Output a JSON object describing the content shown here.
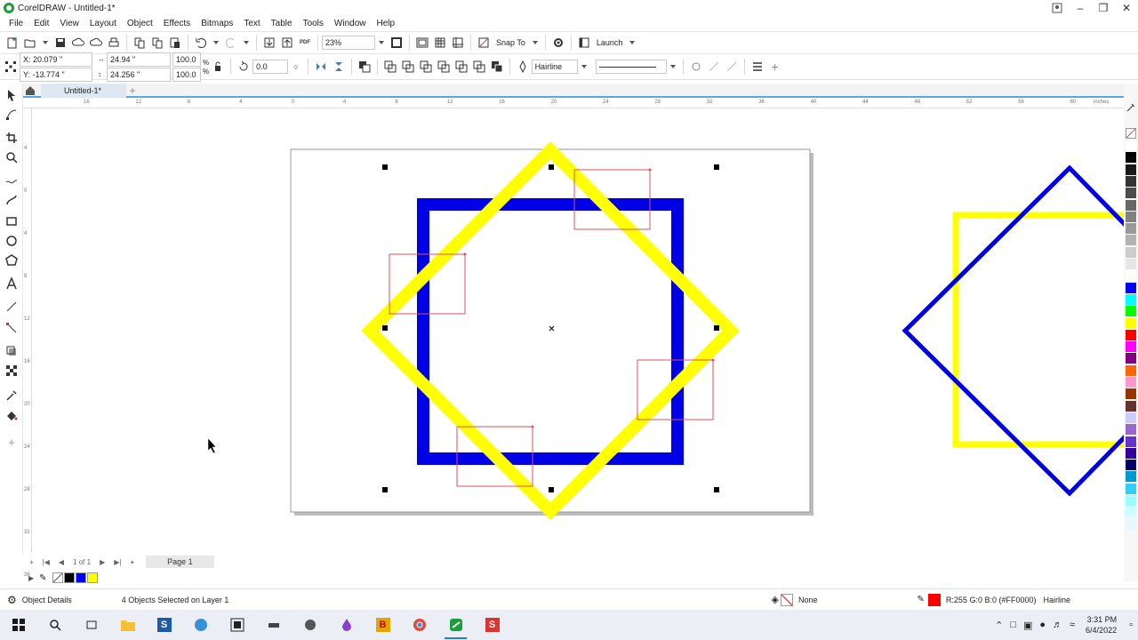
{
  "window": {
    "title": "CorelDRAW - Untitled-1*"
  },
  "menu": [
    "File",
    "Edit",
    "View",
    "Layout",
    "Object",
    "Effects",
    "Bitmaps",
    "Text",
    "Table",
    "Tools",
    "Window",
    "Help"
  ],
  "toolbar": {
    "zoom": "23%",
    "snap_to": "Snap To",
    "launch": "Launch",
    "pdf": "PDF"
  },
  "propertybar": {
    "x": "X: 20.079 \"",
    "y": "Y: -13.774 \"",
    "width": "24.94 \"",
    "height": "24.256 \"",
    "scale_w": "100.0",
    "scale_h": "100.0",
    "percent": "%",
    "rotation": "0.0",
    "outline_width": "Hairline"
  },
  "document": {
    "tab_label": "Untitled-1*"
  },
  "rulers": {
    "h_labels": [
      "16",
      "12",
      "8",
      "4",
      "0",
      "4",
      "8",
      "12",
      "16",
      "20",
      "24",
      "28",
      "32",
      "36",
      "40",
      "44",
      "48",
      "52",
      "56",
      "60"
    ],
    "units": "inches",
    "v_labels": [
      "4",
      "0",
      "4",
      "8",
      "12",
      "16",
      "20",
      "24",
      "28",
      "32",
      "36"
    ]
  },
  "pagenav": {
    "counter": "1 of 1",
    "page_tab": "Page 1"
  },
  "status": {
    "object_details": "Object Details",
    "selection": "4 Objects Selected on Layer 1",
    "fill": "None",
    "outline_color": "R:255 G:0 B:0 (#FF0000)",
    "outline_width": "Hairline"
  },
  "taskbar": {
    "time": "3:31 PM",
    "date": "6/4/2022"
  },
  "colors": {
    "blue": "#0000e6",
    "yellow": "#ffff00",
    "red_outline": "#e05060",
    "accent": "#58a6e8"
  },
  "palette": [
    "#ffffff",
    "#000000",
    "#1a1a1a",
    "#333333",
    "#4d4d4d",
    "#666666",
    "#808080",
    "#999999",
    "#b3b3b3",
    "#cccccc",
    "#e6e6e6",
    "#ffffff",
    "#0000ff",
    "#00ffff",
    "#00ff00",
    "#ffff00",
    "#ff0000",
    "#ff00ff",
    "#800080",
    "#ff6600",
    "#ff99cc",
    "#993300",
    "#663333",
    "#ccccff",
    "#9966cc",
    "#6633cc",
    "#330099",
    "#000066",
    "#0099cc",
    "#33ccff",
    "#99ffff",
    "#ccffff",
    "#e6f7ff"
  ]
}
